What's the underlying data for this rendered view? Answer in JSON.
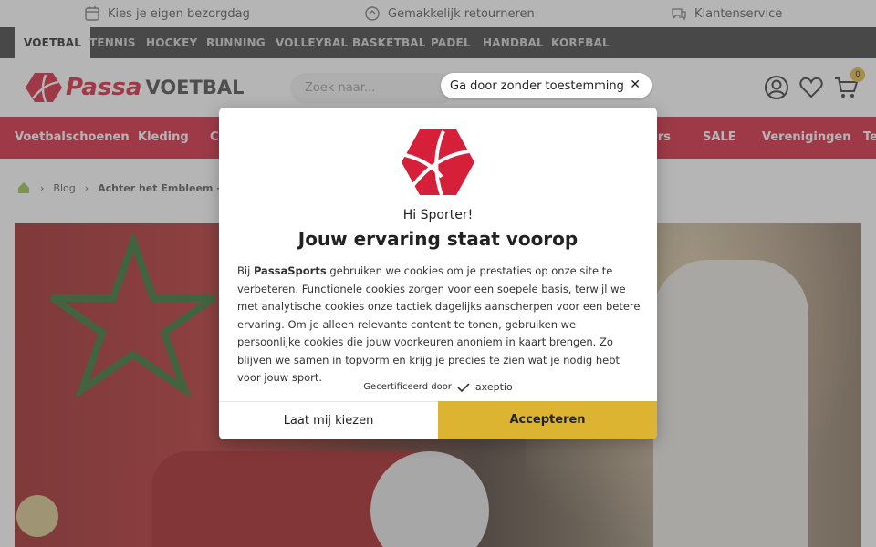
{
  "usp": {
    "items": [
      {
        "label": "Kies je eigen bezorgdag",
        "icon": "calendar-icon"
      },
      {
        "label": "Gemakkelijk retourneren",
        "icon": "return-icon"
      },
      {
        "label": "Klantenservice",
        "icon": "chat-icon"
      }
    ]
  },
  "sports": {
    "tabs": [
      "VOETBAL",
      "TENNIS",
      "HOCKEY",
      "RUNNING",
      "VOLLEYBAL",
      "BASKETBAL",
      "PADEL",
      "HANDBAL",
      "KORFBAL"
    ],
    "active": "VOETBAL"
  },
  "header": {
    "logo_a": "Passa",
    "logo_b": "VOETBAL",
    "search_placeholder": "Zoek naar...",
    "cart_count": "0"
  },
  "catnav": {
    "items": [
      "Voetbalschoenen",
      "Kleding",
      "Cl",
      "ers",
      "SALE",
      "Verenigingen",
      "Te"
    ]
  },
  "breadcrumb": {
    "items": [
      "Blog",
      "Achter het Embleem – Afle"
    ]
  },
  "consent": {
    "skip_label": "Ga door zonder toestemming",
    "greeting": "Hi Sporter!",
    "title": "Jouw ervaring staat voorop",
    "body_prefix": "Bij ",
    "body_brand": "PassaSports",
    "body_text": " gebruiken we cookies om je prestaties op onze site te verbeteren. Functionele cookies zorgen voor een soepele basis, terwijl we met analytische cookies onze tactiek dagelijks aanscherpen voor een betere ervaring. Om je alleen relevante content te tonen, gebruiken we persoonlijke cookies die jouw voorkeuren anoniem in kaart brengen. Zo blijven we samen in topvorm en krijg je precies te zien wat je nodig hebt voor jouw sport.",
    "certified_label": "Gecertificeerd door",
    "certified_brand": "axeptio",
    "choose_label": "Laat mij kiezen",
    "accept_label": "Accepteren"
  },
  "colors": {
    "brand_red": "#d6203a",
    "accept_yellow": "#dcb432",
    "dark_bar": "#3a3a3a"
  }
}
